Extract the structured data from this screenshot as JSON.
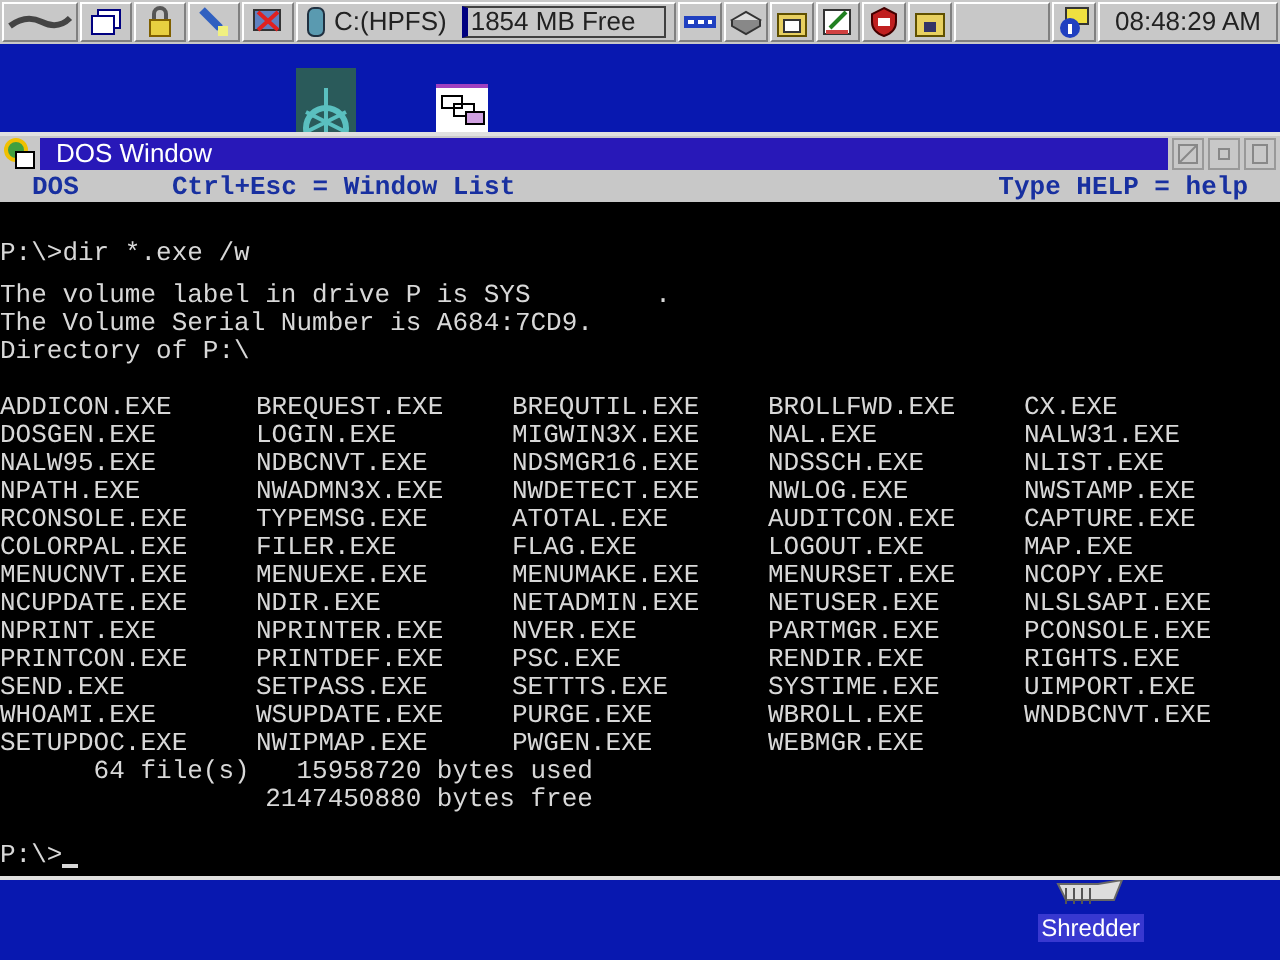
{
  "taskbar": {
    "drive_label": "C:(HPFS)",
    "drive_free": "1854 MB Free",
    "clock": "08:48:29 AM"
  },
  "window": {
    "title": "DOS Window",
    "status": {
      "left": "DOS",
      "middle": "Ctrl+Esc = Window List",
      "right": "Type HELP = help"
    },
    "console": {
      "command": "P:\\>dir *.exe /w",
      "header": [
        "The volume label in drive P is SYS        .",
        "The Volume Serial Number is A684:7CD9.",
        "Directory of P:\\"
      ],
      "files": [
        [
          "ADDICON.EXE",
          "BREQUEST.EXE",
          "BREQUTIL.EXE",
          "BROLLFWD.EXE",
          "CX.EXE"
        ],
        [
          "DOSGEN.EXE",
          "LOGIN.EXE",
          "MIGWIN3X.EXE",
          "NAL.EXE",
          "NALW31.EXE"
        ],
        [
          "NALW95.EXE",
          "NDBCNVT.EXE",
          "NDSMGR16.EXE",
          "NDSSCH.EXE",
          "NLIST.EXE"
        ],
        [
          "NPATH.EXE",
          "NWADMN3X.EXE",
          "NWDETECT.EXE",
          "NWLOG.EXE",
          "NWSTAMP.EXE"
        ],
        [
          "RCONSOLE.EXE",
          "TYPEMSG.EXE",
          "ATOTAL.EXE",
          "AUDITCON.EXE",
          "CAPTURE.EXE"
        ],
        [
          "COLORPAL.EXE",
          "FILER.EXE",
          "FLAG.EXE",
          "LOGOUT.EXE",
          "MAP.EXE"
        ],
        [
          "MENUCNVT.EXE",
          "MENUEXE.EXE",
          "MENUMAKE.EXE",
          "MENURSET.EXE",
          "NCOPY.EXE"
        ],
        [
          "NCUPDATE.EXE",
          "NDIR.EXE",
          "NETADMIN.EXE",
          "NETUSER.EXE",
          "NLSLSAPI.EXE"
        ],
        [
          "NPRINT.EXE",
          "NPRINTER.EXE",
          "NVER.EXE",
          "PARTMGR.EXE",
          "PCONSOLE.EXE"
        ],
        [
          "PRINTCON.EXE",
          "PRINTDEF.EXE",
          "PSC.EXE",
          "RENDIR.EXE",
          "RIGHTS.EXE"
        ],
        [
          "SEND.EXE",
          "SETPASS.EXE",
          "SETTTS.EXE",
          "SYSTIME.EXE",
          "UIMPORT.EXE"
        ],
        [
          "WHOAMI.EXE",
          "WSUPDATE.EXE",
          "PURGE.EXE",
          "WBROLL.EXE",
          "WNDBCNVT.EXE"
        ],
        [
          "SETUPDOC.EXE",
          "NWIPMAP.EXE",
          "PWGEN.EXE",
          "WEBMGR.EXE"
        ]
      ],
      "summary": [
        "      64 file(s)   15958720 bytes used",
        "                 2147450880 bytes free"
      ],
      "prompt": "P:\\>"
    }
  },
  "desktop": {
    "shredder_label": "Shredder"
  }
}
